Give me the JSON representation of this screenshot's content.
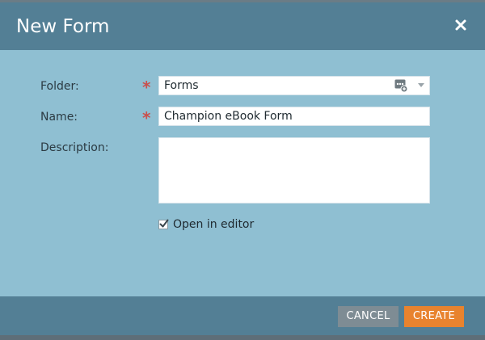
{
  "dialog": {
    "title": "New Form",
    "close_icon": "close-icon"
  },
  "form": {
    "folder": {
      "label": "Folder:",
      "required_marker": "*",
      "value": "Forms",
      "picker_icon": "folder-picker-icon",
      "dropdown_icon": "chevron-down-icon"
    },
    "name": {
      "label": "Name:",
      "required_marker": "*",
      "value": "Champion eBook Form"
    },
    "description": {
      "label": "Description:",
      "value": ""
    },
    "open_in_editor": {
      "label": "Open in editor",
      "checked": true
    }
  },
  "footer": {
    "cancel_label": "CANCEL",
    "create_label": "CREATE"
  },
  "colors": {
    "header_bg": "#537f95",
    "body_bg": "#8fbfd2",
    "required": "#c9504d",
    "cancel_bg": "#7e8c94",
    "create_bg": "#e8832e"
  }
}
